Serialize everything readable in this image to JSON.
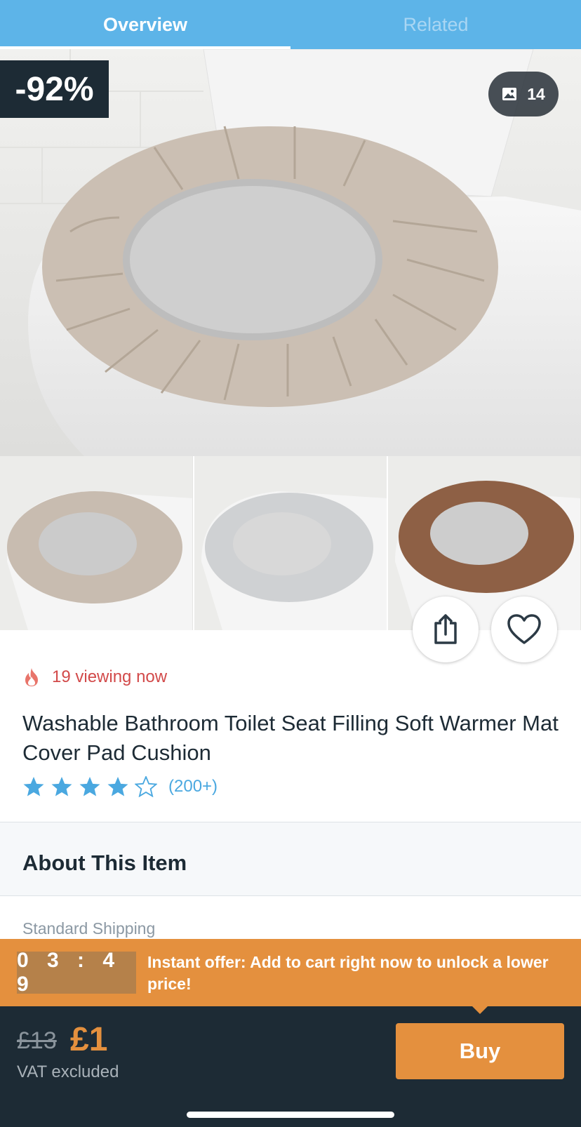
{
  "tabs": [
    {
      "label": "Overview"
    },
    {
      "label": "Related"
    }
  ],
  "hero": {
    "discount": "-92%",
    "photo_count": "14"
  },
  "product": {
    "viewing": "19 viewing now",
    "title": "Washable Bathroom Toilet Seat Filling Soft Warmer Mat Cover Pad Cushion",
    "rating": 4,
    "rating_max": 5,
    "rating_count": "(200+)"
  },
  "sections": {
    "about_title": "About This Item",
    "shipping_label": "Standard Shipping"
  },
  "offer": {
    "timer": "03:49",
    "text": "Instant offer: Add to cart right now to unlock a lower price!"
  },
  "purchase": {
    "old_price": "£13",
    "new_price": "£1",
    "vat_note": "VAT excluded",
    "buy_label": "Buy"
  },
  "colors": {
    "tab_bar": "#5db4e8",
    "accent": "#e4903e",
    "dark": "#1d2b35",
    "star": "#4aa8e0",
    "viewing": "#d24a4a"
  }
}
